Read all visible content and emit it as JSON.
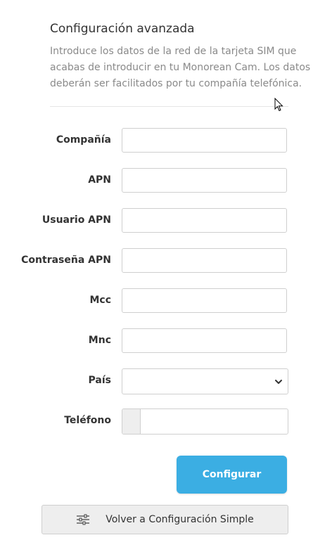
{
  "header": {
    "title": "Configuración avanzada",
    "description": "Introduce los datos de la red de la tarjeta SIM que acabas de introducir en tu Monorean Cam. Los datos deberán ser facilitados por tu compañía telefónica."
  },
  "form": {
    "fields": [
      {
        "label": "Compañía",
        "value": ""
      },
      {
        "label": "APN",
        "value": ""
      },
      {
        "label": "Usuario APN",
        "value": ""
      },
      {
        "label": "Contraseña APN",
        "value": ""
      },
      {
        "label": "Mcc",
        "value": ""
      },
      {
        "label": "Mnc",
        "value": ""
      }
    ],
    "country": {
      "label": "País",
      "selected": ""
    },
    "phone": {
      "label": "Teléfono",
      "value": ""
    }
  },
  "buttons": {
    "configure": "Configurar",
    "back_simple": "Volver a Configuración Simple"
  },
  "colors": {
    "primary": "#3baee3",
    "secondary_bg": "#eeeeee"
  }
}
